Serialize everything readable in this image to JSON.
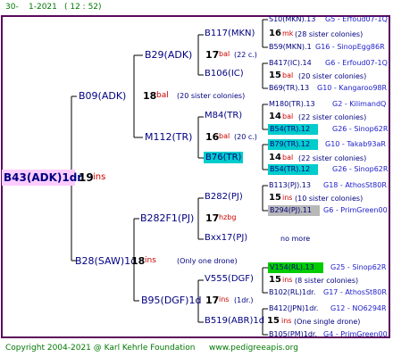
{
  "header": {
    "left": "30-",
    "date": "1-2021",
    "time": "( 12 : 52)"
  },
  "root": {
    "name": "B43(ADK)1dr",
    "num": "19",
    "sfx": "ins"
  },
  "g1": {
    "upper": {
      "name": "B09(ADK)",
      "num": "18",
      "sfx": "bal",
      "note": "(20 sister colonies)"
    },
    "lower": {
      "name": "B28(SAW)1d",
      "num": "18",
      "sfx": "ins",
      "note": "(Only one drone)"
    }
  },
  "g2": {
    "a": {
      "name": "B29(ADK)",
      "num": "17",
      "sfx": "bal",
      "note": "(22 c.)"
    },
    "b": {
      "name": "M112(TR)",
      "num": "16",
      "sfx": "bal",
      "note": "(20 c.)"
    },
    "c": {
      "name": "B282F1(PJ)",
      "num": "17",
      "sfx": "hzbg"
    },
    "d": {
      "name": "B95(DGF)1d",
      "num": "17",
      "sfx": "ins",
      "note": "(1dr.)"
    }
  },
  "g3": [
    {
      "name": "B117(MKN)"
    },
    {
      "name": "B106(IC)"
    },
    {
      "name": "M84(TR)"
    },
    {
      "name": "B76(TR)"
    },
    {
      "name": "B282(PJ)"
    },
    {
      "name": "Bxx17(PJ)",
      "note": "no more"
    },
    {
      "name": "V555(DGF)"
    },
    {
      "name": "B519(ABR)1d",
      "num": "15",
      "sfx": "ins",
      "note": "(One single drone)"
    }
  ],
  "g4": [
    {
      "row": "S10(MKN).13",
      "tag": "G5 - Erfoud07-1Q"
    },
    {
      "num": "16",
      "sfx": "mk",
      "note": "(28 sister colonies)"
    },
    {
      "row": "B59(MKN).1",
      "tag": "G16 - SinopEgg86R"
    },
    {
      "row": "B417(IC).14",
      "tag": "G6 - Erfoud07-1Q"
    },
    {
      "num": "15",
      "sfx": "bal",
      "note": "(20 sister colonies)"
    },
    {
      "row": "B69(TR).13",
      "tag": "G10 - Kangaroo98R"
    },
    {
      "row": "M180(TR).13",
      "tag": "G2 - KilimandQ"
    },
    {
      "num": "14",
      "sfx": "bal",
      "note": "(22 sister colonies)"
    },
    {
      "row": "B54(TR).12",
      "tag": "G26 - Sinop62R"
    },
    {
      "row": "B79(TR).12",
      "tag": "G10 - Takab93aR"
    },
    {
      "num": "14",
      "sfx": "bal",
      "note": "(22 sister colonies)"
    },
    {
      "row": "B54(TR).12",
      "tag": "G26 - Sinop62R"
    },
    {
      "row": "B113(PJ).13",
      "tag": "G18 - AthosSt80R"
    },
    {
      "num": "15",
      "sfx": "ins",
      "note": "(10 sister colonies)"
    },
    {
      "row": "B294(PJ).11",
      "tag": "G6 - PrimGreen00"
    },
    {
      "row": "V154(RL).13",
      "tag": "G25 - Sinop62R"
    },
    {
      "num": "15",
      "sfx": "ins",
      "note": "(8 sister colonies)"
    },
    {
      "row": "B102(RL)1dr.",
      "tag": "G17 - AthosSt80R"
    },
    {
      "row": "B412(JPN)1dr.",
      "tag": "G12 - NO6294R"
    },
    {
      "row": "B105(PM)1dr.",
      "tag": "G4 - PrimGreen00"
    }
  ],
  "footer": {
    "copyright": "Copyright 2004-2021 @ Karl Kehrle Foundation",
    "site": "www.pedigreeapis.org"
  },
  "colors": {
    "frame": "#5a0a5a",
    "root_bg": "#ffccff",
    "cyan": "#00cccc",
    "green": "#00cc00",
    "gray": "#b8b8b8"
  }
}
